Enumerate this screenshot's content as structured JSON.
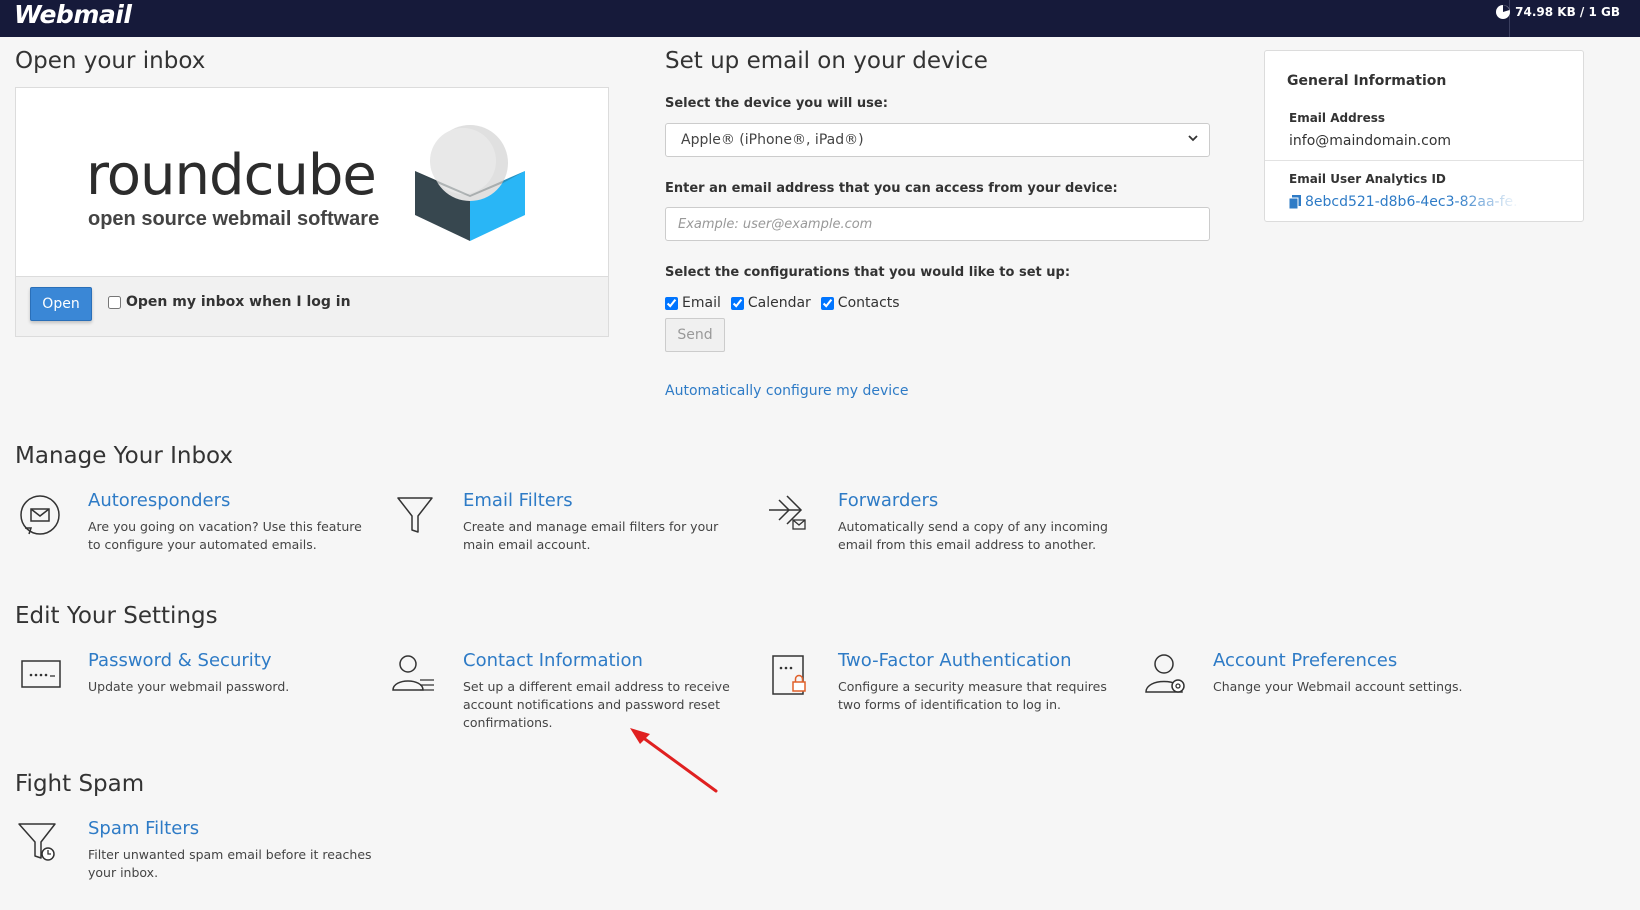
{
  "header": {
    "brand": "Webmail",
    "quota": "74.98 KB / 1 GB"
  },
  "open_inbox": {
    "title": "Open your inbox",
    "logo_word": "roundcube",
    "logo_tagline": "open source webmail software",
    "open_button": "Open",
    "auto_open_label": "Open my inbox when I log in",
    "auto_open_checked": false
  },
  "setup": {
    "title": "Set up email on your device",
    "device_label": "Select the device you will use:",
    "device_value": "Apple® (iPhone®, iPad®)",
    "email_label": "Enter an email address that you can access from your device:",
    "email_placeholder": "Example: user@example.com",
    "config_label": "Select the configurations that you would like to set up:",
    "configs": [
      {
        "label": "Email",
        "checked": true
      },
      {
        "label": "Calendar",
        "checked": true
      },
      {
        "label": "Contacts",
        "checked": true
      }
    ],
    "send_button": "Send",
    "auto_config_link": "Automatically configure my device"
  },
  "general_info": {
    "title": "General Information",
    "email_address_label": "Email Address",
    "email_address": "info@maindomain.com",
    "analytics_label": "Email User Analytics ID",
    "analytics_id": "8ebcd521-d8b6-4ec3-82aa-fe..."
  },
  "manage": {
    "title": "Manage Your Inbox",
    "items": [
      {
        "title": "Autoresponders",
        "desc": "Are you going on vacation? Use this feature to configure your automated emails.",
        "icon": "autoresponder-icon"
      },
      {
        "title": "Email Filters",
        "desc": "Create and manage email filters for your main email account.",
        "icon": "filter-icon"
      },
      {
        "title": "Forwarders",
        "desc": "Automatically send a copy of any incoming email from this email address to another.",
        "icon": "forward-icon"
      }
    ]
  },
  "settings": {
    "title": "Edit Your Settings",
    "items": [
      {
        "title": "Password & Security",
        "desc": "Update your webmail password.",
        "icon": "password-icon"
      },
      {
        "title": "Contact Information",
        "desc": "Set up a different email address to receive account notifications and password reset confirmations.",
        "icon": "contact-icon"
      },
      {
        "title": "Two-Factor Authentication",
        "desc": "Configure a security measure that requires two forms of identification to log in.",
        "icon": "two-factor-icon"
      },
      {
        "title": "Account Preferences",
        "desc": "Change your Webmail account settings.",
        "icon": "preferences-icon"
      }
    ]
  },
  "spam": {
    "title": "Fight Spam",
    "items": [
      {
        "title": "Spam Filters",
        "desc": "Filter unwanted spam email before it reaches your inbox.",
        "icon": "spam-filter-icon"
      }
    ]
  },
  "colors": {
    "topbar": "#161a3a",
    "link": "#2e7bc6",
    "open_button": "#3a87d6",
    "annotation_arrow": "#e02020"
  }
}
